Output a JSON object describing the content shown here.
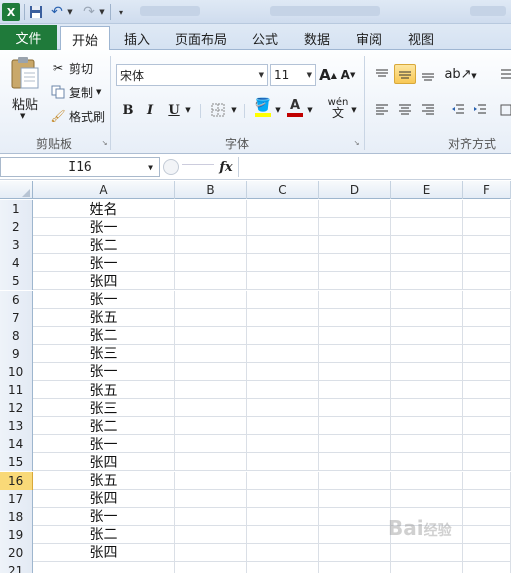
{
  "quick_access": {
    "logo_label": "X",
    "save_icon": "save-icon",
    "undo_icon": "undo-icon",
    "redo_icon": "redo-icon"
  },
  "tabs": [
    {
      "label": "文件"
    },
    {
      "label": "开始"
    },
    {
      "label": "插入"
    },
    {
      "label": "页面布局"
    },
    {
      "label": "公式"
    },
    {
      "label": "数据"
    },
    {
      "label": "审阅"
    },
    {
      "label": "视图"
    }
  ],
  "ribbon": {
    "clipboard": {
      "paste_label": "粘贴",
      "cut_label": "剪切",
      "copy_label": "复制",
      "format_painter_label": "格式刷",
      "group_label": "剪贴板"
    },
    "font": {
      "font_name": "宋体",
      "font_size": "11",
      "bold": "B",
      "italic": "I",
      "underline": "U",
      "font_color_glyph": "A",
      "grow_glyph": "A",
      "shrink_glyph": "A",
      "phonetic_glyph": "wén",
      "group_label": "字体"
    },
    "alignment": {
      "group_label": "对齐方式"
    }
  },
  "formula_bar": {
    "name_box": "I16",
    "fx_label": "fx",
    "formula": ""
  },
  "grid": {
    "columns": [
      "A",
      "B",
      "C",
      "D",
      "E",
      "F"
    ],
    "selected_row": 16,
    "rows": [
      {
        "num": "1",
        "A": "姓名"
      },
      {
        "num": "2",
        "A": "张一"
      },
      {
        "num": "3",
        "A": "张二"
      },
      {
        "num": "4",
        "A": "张一"
      },
      {
        "num": "5",
        "A": "张四"
      },
      {
        "num": "6",
        "A": "张一"
      },
      {
        "num": "7",
        "A": "张五"
      },
      {
        "num": "8",
        "A": "张二"
      },
      {
        "num": "9",
        "A": "张三"
      },
      {
        "num": "10",
        "A": "张一"
      },
      {
        "num": "11",
        "A": "张五"
      },
      {
        "num": "12",
        "A": "张三"
      },
      {
        "num": "13",
        "A": "张二"
      },
      {
        "num": "14",
        "A": "张一"
      },
      {
        "num": "15",
        "A": "张四"
      },
      {
        "num": "16",
        "A": "张五"
      },
      {
        "num": "17",
        "A": "张四"
      },
      {
        "num": "18",
        "A": "张一"
      },
      {
        "num": "19",
        "A": "张二"
      },
      {
        "num": "20",
        "A": "张四"
      },
      {
        "num": "21",
        "A": ""
      }
    ]
  },
  "colors": {
    "file_tab": "#1f7a3a",
    "selected_row_header": "#f9d978",
    "highlight_button": "#f8c855"
  }
}
